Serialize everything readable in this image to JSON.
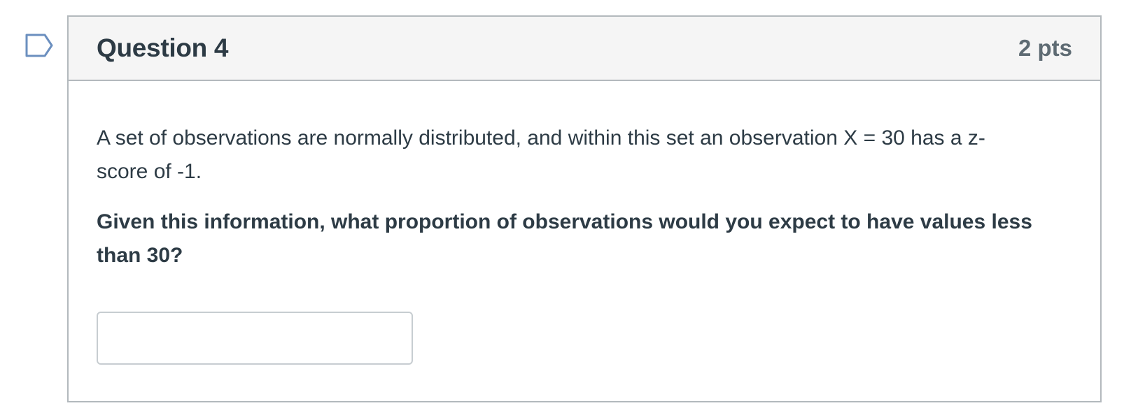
{
  "question": {
    "title": "Question 4",
    "points": "2 pts",
    "flag_icon": "flag-outline-icon",
    "body_text": "A set of observations are normally distributed, and within this set an observation X = 30 has a z-score of -1.",
    "prompt": "Given this information, what proportion of observations would you expect to have values less than 30?",
    "answer": {
      "value": "",
      "placeholder": ""
    }
  },
  "colors": {
    "text": "#2d3b45",
    "points": "#5e6b73",
    "border": "#b3b9bd",
    "header_bg": "#f5f5f5",
    "flag": "#6b8fbf"
  }
}
